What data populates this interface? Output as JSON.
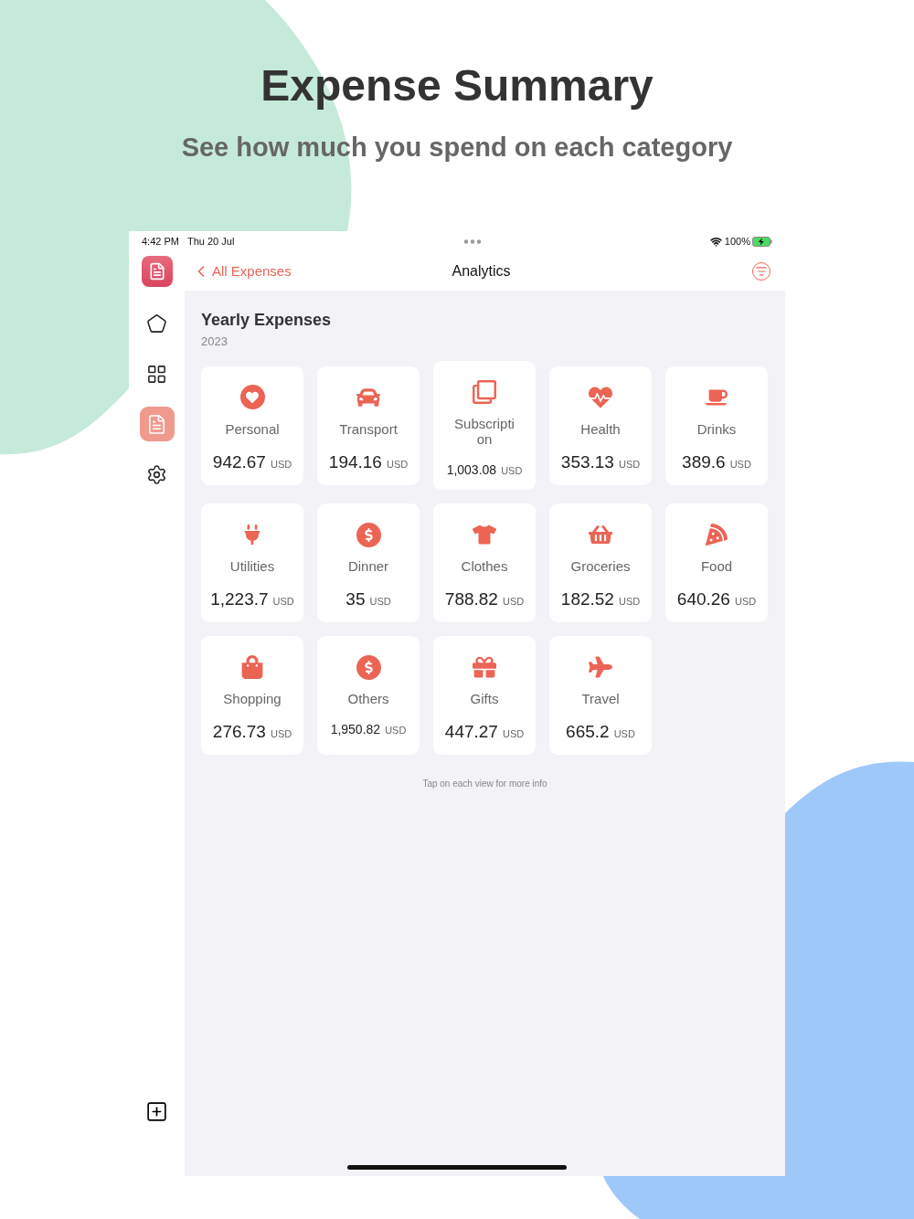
{
  "headline": {
    "title": "Expense Summary",
    "subtitle": "See how much you spend on each category"
  },
  "status_bar": {
    "time": "4:42 PM",
    "date": "Thu 20 Jul",
    "battery": "100%"
  },
  "sidebar": {
    "items": [
      {
        "selected": false
      },
      {
        "selected": false
      },
      {
        "selected": true
      },
      {
        "selected": false
      }
    ]
  },
  "nav": {
    "back": "All Expenses",
    "title": "Analytics"
  },
  "section": {
    "title": "Yearly Expenses",
    "year": "2023"
  },
  "categories": [
    {
      "name": "Personal",
      "amount": "942.67",
      "currency": "USD"
    },
    {
      "name": "Transport",
      "amount": "194.16",
      "currency": "USD"
    },
    {
      "name": "Subscription",
      "amount": "1,003.08",
      "currency": "USD"
    },
    {
      "name": "Health",
      "amount": "353.13",
      "currency": "USD"
    },
    {
      "name": "Drinks",
      "amount": "389.6",
      "currency": "USD"
    },
    {
      "name": "Utilities",
      "amount": "1,223.7",
      "currency": "USD"
    },
    {
      "name": "Dinner",
      "amount": "35",
      "currency": "USD"
    },
    {
      "name": "Clothes",
      "amount": "788.82",
      "currency": "USD"
    },
    {
      "name": "Groceries",
      "amount": "182.52",
      "currency": "USD"
    },
    {
      "name": "Food",
      "amount": "640.26",
      "currency": "USD"
    },
    {
      "name": "Shopping",
      "amount": "276.73",
      "currency": "USD"
    },
    {
      "name": "Others",
      "amount": "1,950.82",
      "currency": "USD"
    },
    {
      "name": "Gifts",
      "amount": "447.27",
      "currency": "USD"
    },
    {
      "name": "Travel",
      "amount": "665.2",
      "currency": "USD"
    }
  ],
  "hint": "Tap on each view for more info"
}
